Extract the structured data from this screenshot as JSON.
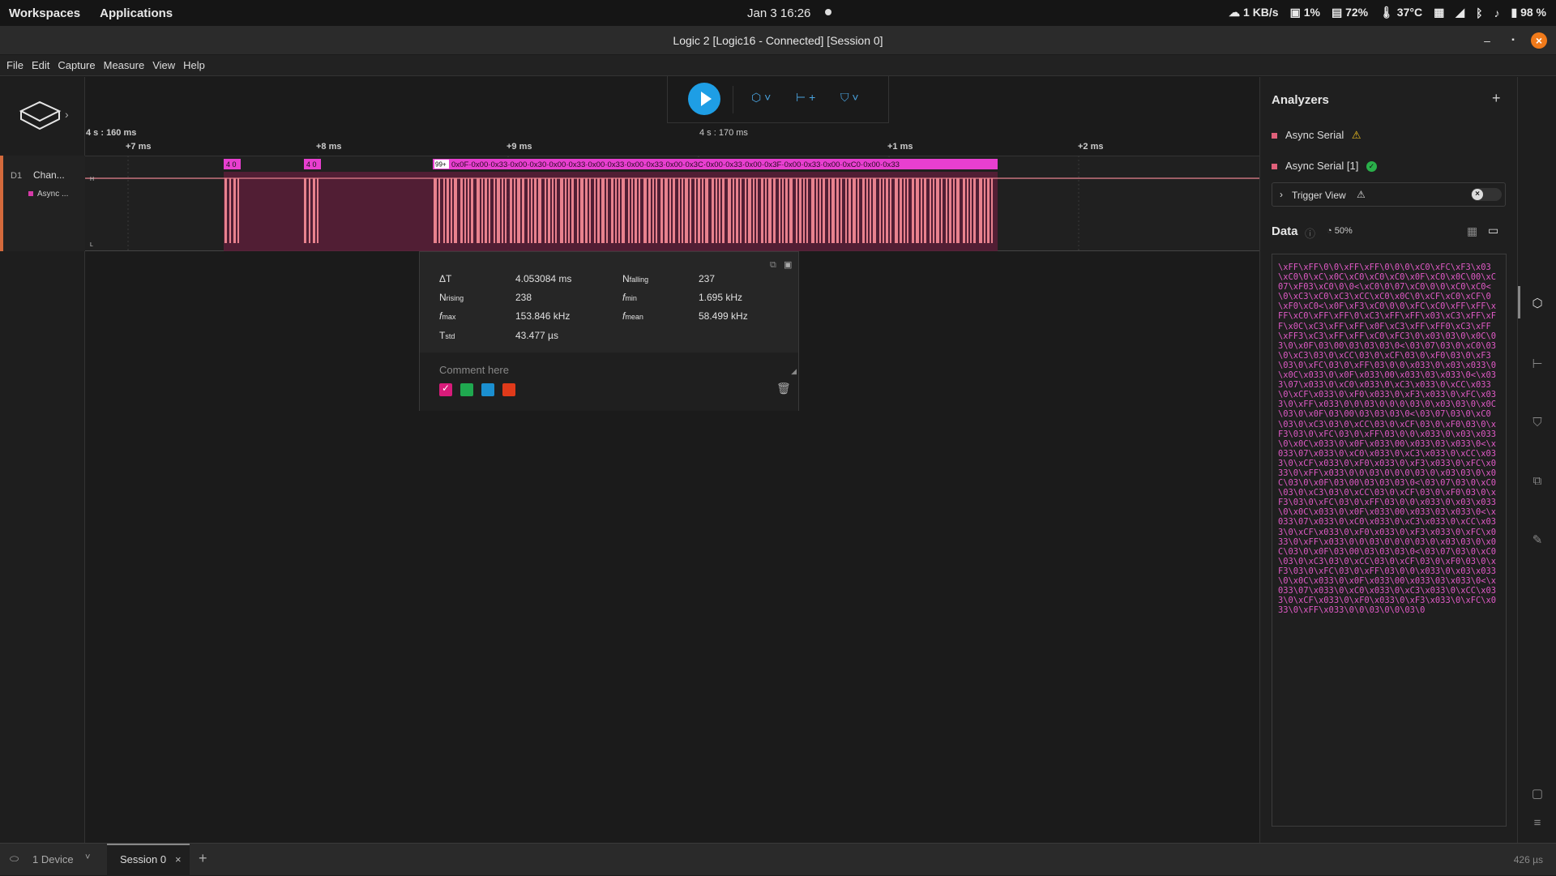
{
  "topbar": {
    "workspaces": "Workspaces",
    "applications": "Applications",
    "clock": "Jan 3   16:26",
    "net": "1 KB/s",
    "cpu": "1%",
    "mem": "72%",
    "temp": "37°C",
    "battery": "98 %"
  },
  "window": {
    "title": "Logic 2 [Logic16 - Connected] [Session 0]"
  },
  "menu": [
    "File",
    "Edit",
    "Capture",
    "Measure",
    "View",
    "Help"
  ],
  "ruler": {
    "origin": "4 s : 160 ms",
    "center": "4 s : 170 ms",
    "ticks": [
      "+7 ms",
      "+8 ms",
      "+9 ms",
      "+1 ms",
      "+2 ms"
    ]
  },
  "channel": {
    "id": "D1",
    "name": "Chan...",
    "analyzer": "Async ...",
    "high": "H",
    "low": "L",
    "bubble1": "4 0",
    "bubble2": "4 0",
    "badge": "99+",
    "frames": "0x0F·0x00·0x33·0x00·0x30·0x00·0x33·0x00·0x33·0x00·0x33·0x00·0x3C·0x00·0x33·0x00·0x3F·0x00·0x33·0x00·0xC0·0x00·0x33"
  },
  "measurement": {
    "dt_label": "ΔT",
    "dt_value": "4.053084 ms",
    "nfall_label": "N",
    "nfall_sub": "falling",
    "nfall_value": "237",
    "nrise_label": "N",
    "nrise_sub": "rising",
    "nrise_value": "238",
    "fmin_label": "f",
    "fmin_sub": "min",
    "fmin_value": "1.695 kHz",
    "fmax_label": "f",
    "fmax_sub": "max",
    "fmax_value": "153.846 kHz",
    "fmean_label": "f",
    "fmean_sub": "mean",
    "fmean_value": "58.499 kHz",
    "tstd_label": "T",
    "tstd_sub": "std",
    "tstd_value": "43.477 µs",
    "comment_placeholder": "Comment here",
    "swatch_colors": [
      "#d81b7a",
      "#1fa84f",
      "#1b8fd0",
      "#e03a1a"
    ]
  },
  "analyzers": {
    "title": "Analyzers",
    "items": [
      {
        "label": "Async Serial",
        "status": "warning"
      },
      {
        "label": "Async Serial [1]",
        "status": "ok"
      }
    ],
    "trigger_label": "Trigger View",
    "data_title": "Data",
    "progress": "50%",
    "data_text": "\\xFF\\xFF\\0\\0\\xFF\\xFF\\0\\0\\0\\xC0\\xFC\\xF3\\x03\\xC0\\0\\xC\\x0C\\xC0\\xC0\\xC0\\x0F\\xC0\\x0C\\00\\xC07\\xF03\\xC0\\0\\0<\\xC0\\0\\07\\xC0\\0\\0\\xC0\\xC0<\\0\\xC3\\xC0\\xC3\\xCC\\xC0\\x0C\\0\\xCF\\xC0\\xCF\\0\\xF0\\xC0<\\x0F\\xF3\\xC0\\0\\0\\xFC\\xC0\\xFF\\xFF\\xFF\\xC0\\xFF\\xFF\\0\\xC3\\xFF\\xFF\\x03\\xC3\\xFF\\xFF\\x0C\\xC3\\xFF\\xFF\\x0F\\xC3\\xFF\\xFF0\\xC3\\xFF\\xFF3\\xC3\\xFF\\xFF\\xC0\\xFC3\\0\\x03\\03\\0\\x0C\\03\\0\\x0F\\03\\00\\03\\03\\03\\0<\\03\\07\\03\\0\\xC0\\03\\0\\xC3\\03\\0\\xCC\\03\\0\\xCF\\03\\0\\xF0\\03\\0\\xF3\\03\\0\\xFC\\03\\0\\xFF\\03\\0\\0\\x033\\0\\x03\\x033\\0\\x0C\\x033\\0\\x0F\\x033\\00\\x033\\03\\x033\\0<\\x033\\07\\x033\\0\\xC0\\x033\\0\\xC3\\x033\\0\\xCC\\x033\\0\\xCF\\x033\\0\\xF0\\x033\\0\\xF3\\x033\\0\\xFC\\x033\\0\\xFF\\x033\\0\\0\\03\\0\\0\\0\\03\\0\\x03\\03\\0\\x0C\\03\\0\\x0F\\03\\00\\03\\03\\03\\0<\\03\\07\\03\\0\\xC0\\03\\0\\xC3\\03\\0\\xCC\\03\\0\\xCF\\03\\0\\xF0\\03\\0\\xF3\\03\\0\\xFC\\03\\0\\xFF\\03\\0\\0\\x033\\0\\x03\\x033\\0\\x0C\\x033\\0\\x0F\\x033\\00\\x033\\03\\x033\\0<\\x033\\07\\x033\\0\\xC0\\x033\\0\\xC3\\x033\\0\\xCC\\x033\\0\\xCF\\x033\\0\\xF0\\x033\\0\\xF3\\x033\\0\\xFC\\x033\\0\\xFF\\x033\\0\\0\\03\\0\\0\\0\\03\\0\\x03\\03\\0\\x0C\\03\\0\\x0F\\03\\00\\03\\03\\03\\0<\\03\\07\\03\\0\\xC0\\03\\0\\xC3\\03\\0\\xCC\\03\\0\\xCF\\03\\0\\xF0\\03\\0\\xF3\\03\\0\\xFC\\03\\0\\xFF\\03\\0\\0\\x033\\0\\x03\\x033\\0\\x0C\\x033\\0\\x0F\\x033\\00\\x033\\03\\x033\\0<\\x033\\07\\x033\\0\\xC0\\x033\\0\\xC3\\x033\\0\\xCC\\x033\\0\\xCF\\x033\\0\\xF0\\x033\\0\\xF3\\x033\\0\\xFC\\x033\\0\\xFF\\x033\\0\\0\\03\\0\\0\\0\\03\\0\\x03\\03\\0\\x0C\\03\\0\\x0F\\03\\00\\03\\03\\03\\0<\\03\\07\\03\\0\\xC0\\03\\0\\xC3\\03\\0\\xCC\\03\\0\\xCF\\03\\0\\xF0\\03\\0\\xF3\\03\\0\\xFC\\03\\0\\xFF\\03\\0\\0\\x033\\0\\x03\\x033\\0\\x0C\\x033\\0\\x0F\\x033\\00\\x033\\03\\x033\\0<\\x033\\07\\x033\\0\\xC0\\x033\\0\\xC3\\x033\\0\\xCC\\x033\\0\\xCF\\x033\\0\\xF0\\x033\\0\\xF3\\x033\\0\\xFC\\x033\\0\\xFF\\x033\\0\\0\\03\\0\\0\\03\\0"
  },
  "bottom": {
    "device": "1 Device",
    "session": "Session 0",
    "add": "+",
    "close": "×",
    "timing": "426 µs"
  },
  "colors": {
    "accent": "#1e9ee5",
    "signal": "#e8828e",
    "frame": "#e83fd0",
    "hex": "#e05ac6"
  }
}
